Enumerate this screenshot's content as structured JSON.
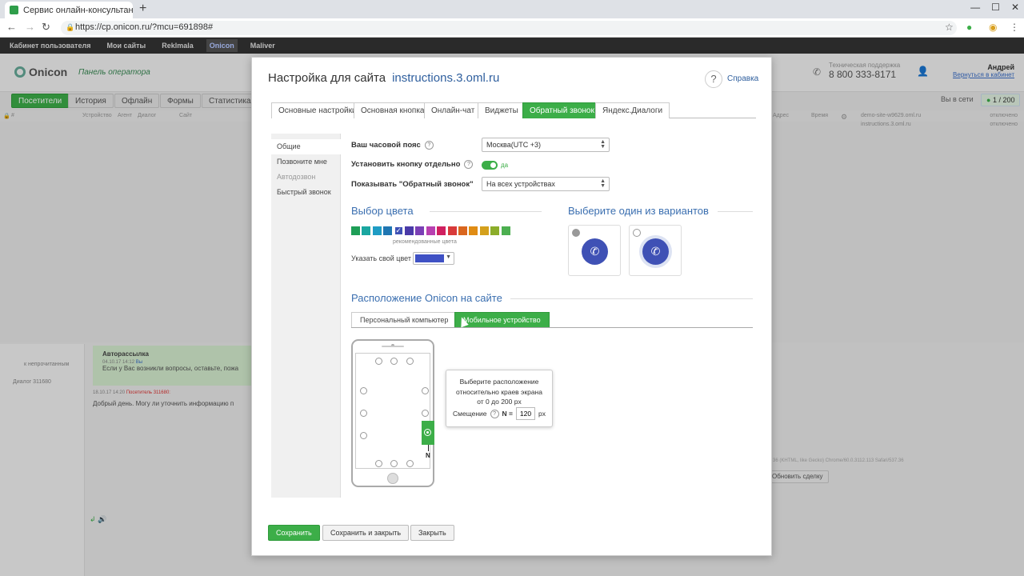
{
  "browser": {
    "tab_title": "Сервис онлайн-консультант Onicon",
    "url": "https://cp.onicon.ru/?mcu=691898#"
  },
  "app": {
    "nav": [
      "Кабинет пользователя",
      "Мои сайты",
      "Reklmala",
      "Onicon",
      "Maliver"
    ],
    "active_nav": "Onicon",
    "logo": "Onicon",
    "panel_label": "Панель оператора",
    "support_label": "Техническая поддержка",
    "support_phone": "8 800 333-8171",
    "user_name": "Андрей",
    "user_back_link": "Вернуться в кабинет",
    "toolbar": [
      "Посетители",
      "История",
      "Офлайн",
      "Формы",
      "Статистика"
    ],
    "online_label": "Вы в сети",
    "online_count": "1 / 200",
    "columns": [
      "#",
      "Устройство",
      "Агент",
      "Диалог",
      "Сайт",
      "Адрес",
      "Время"
    ],
    "right_sites": [
      {
        "name": "demo-site-w9629.oml.ru",
        "status": "отключено"
      },
      {
        "name": "instructions.3.oml.ru",
        "status": "отключено"
      }
    ],
    "left_items": [
      "к непрочитанным",
      "Диалог 311680"
    ],
    "chat": {
      "header": "Авторассылка",
      "time1": "04.10.17 14:12",
      "sender1": "Вы",
      "text1": "Если у Вас возникли вопросы, оставьте, пожа",
      "time2": "18.10.17 14:20",
      "sender2": "Посетитель 311680:",
      "text2": "Добрый день. Могу ли уточнить информацию п"
    },
    "useragent": "36 (KHTML, like Gecko) Chrome/60.0.3112.113 Safari/537.36",
    "update_button": "Обновить сделку"
  },
  "modal": {
    "title": "Настройка для сайта",
    "site": "instructions.3.oml.ru",
    "help_label": "Справка",
    "tabs": [
      "Основные настройки",
      "Основная кнопка",
      "Онлайн-чат",
      "Виджеты",
      "Обратный звонок",
      "Яндекс.Диалоги"
    ],
    "active_tab": "Обратный звонок",
    "side_nav": [
      "Общие",
      "Позвоните мне",
      "Автодозвон",
      "Быстрый звонок"
    ],
    "timezone_label": "Ваш часовой пояс",
    "timezone_value": "Москва(UTC +3)",
    "separate_button_label": "Установить кнопку отдельно",
    "separate_button_value": "да",
    "show_callback_label": "Показывать \"Обратный звонок\"",
    "show_callback_value": "На всех устройствах",
    "color_section": "Выбор цвета",
    "swatches": [
      "#1e9e57",
      "#1aa6a0",
      "#1e9cc4",
      "#1f76b2",
      "#3f51b5",
      "#4a3aa8",
      "#7a3fb5",
      "#b840b0",
      "#d02060",
      "#d83a3a",
      "#d9661e",
      "#e08c14",
      "#d4a01c",
      "#8cad2a",
      "#4caf50"
    ],
    "selected_swatch": 4,
    "swatch_note": "рекомендованные цвета",
    "own_color_label": "Указать свой цвет",
    "own_color": "#3f51c4",
    "variant_section": "Выберите один из вариантов",
    "location_section": "Расположение Onicon на сайте",
    "location_tabs": [
      "Персональный компьютер",
      "Мобильное устройство"
    ],
    "active_location_tab": "Мобильное устройство",
    "n_label": "N",
    "popover": {
      "line1": "Выберите расположение",
      "line2": "относительно краев экрана",
      "line3": "от 0 до 200 px",
      "offset_label": "Смещение",
      "n_eq": "N =",
      "value": "120",
      "unit": "px"
    },
    "buttons": {
      "save": "Сохранить",
      "save_close": "Сохранить и закрыть",
      "close": "Закрыть"
    }
  }
}
